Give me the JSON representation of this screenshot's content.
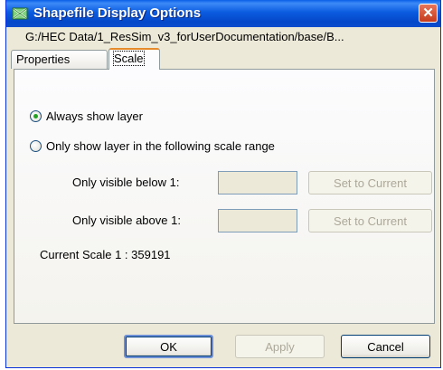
{
  "window": {
    "title": "Shapefile Display Options",
    "close_glyph": "✕",
    "path": "G:/HEC Data/1_ResSim_v3_forUserDocumentation/base/B..."
  },
  "tabs": [
    {
      "label": "Properties",
      "active": false
    },
    {
      "label": "Scale",
      "active": true
    }
  ],
  "scale": {
    "always_show_label": "Always show layer",
    "always_show_checked": true,
    "range_label": "Only show layer in the following scale range",
    "range_checked": false,
    "below_label": "Only visible below 1:",
    "below_value": "",
    "above_label": "Only visible above 1:",
    "above_value": "",
    "set_current_label": "Set to Current",
    "current_scale_text": "Current Scale 1 : 359191"
  },
  "buttons": {
    "ok": "OK",
    "apply": "Apply",
    "cancel": "Cancel"
  },
  "icons": {
    "title_icon": "map-layer-icon",
    "close_icon": "close-icon"
  },
  "colors": {
    "titlebar": "#0548c9",
    "dialog_bg": "#ece9d8",
    "active_tab_accent": "#e68b2c",
    "radio_dot": "#21a121"
  }
}
